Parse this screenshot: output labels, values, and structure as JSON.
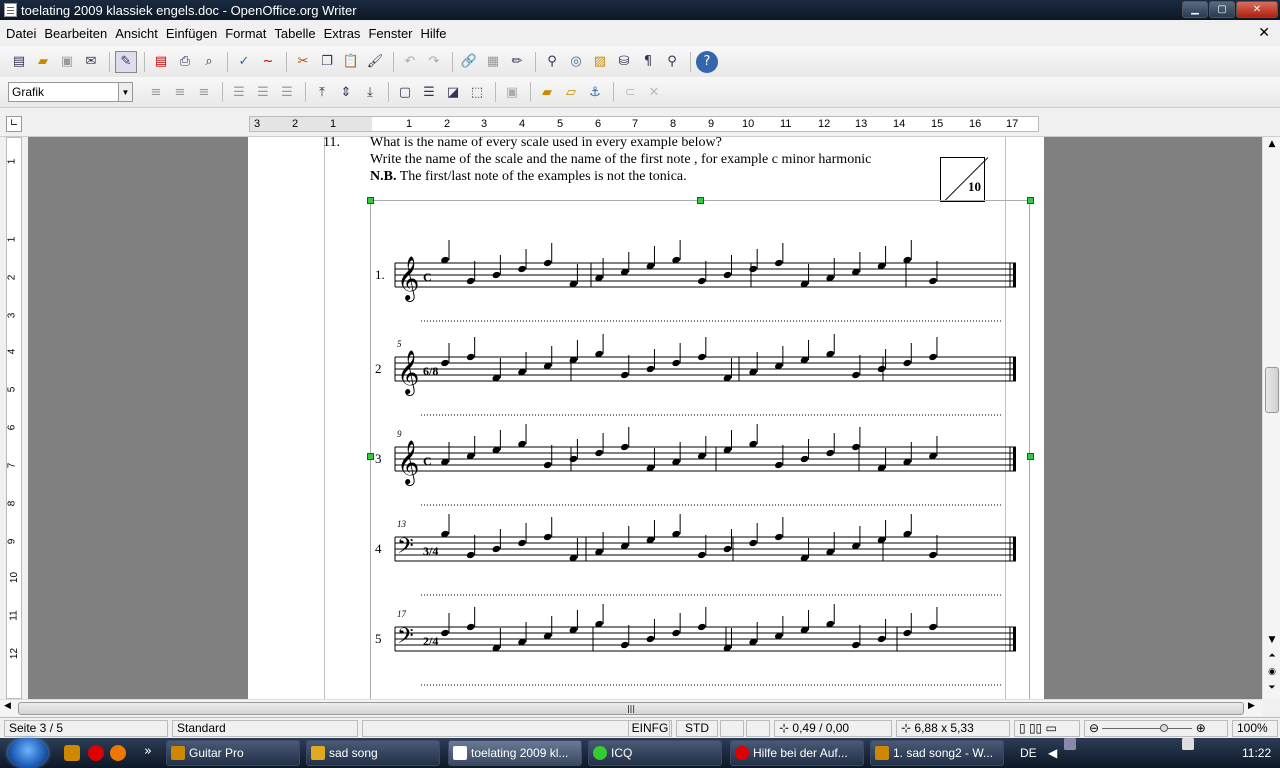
{
  "window": {
    "title": "toelating 2009 klassiek engels.doc - OpenOffice.org Writer",
    "min": "▁",
    "max": "▢",
    "close": "✕"
  },
  "menu": {
    "items": [
      "Datei",
      "Bearbeiten",
      "Ansicht",
      "Einfügen",
      "Format",
      "Tabelle",
      "Extras",
      "Fenster",
      "Hilfe"
    ],
    "close": "✕"
  },
  "toolbar2": {
    "style_value": "Grafik"
  },
  "ruler": {
    "h_neg": [
      "3",
      "2",
      "1"
    ],
    "h_pos": [
      "1",
      "2",
      "3",
      "4",
      "5",
      "6",
      "7",
      "8",
      "9",
      "10",
      "11",
      "12",
      "13",
      "14",
      "15",
      "16",
      "17"
    ],
    "v": [
      "1",
      "1",
      "2",
      "3",
      "4",
      "5",
      "6",
      "7",
      "8",
      "9",
      "10",
      "11",
      "12"
    ]
  },
  "document": {
    "question_number": "11.",
    "line1": "What is the name of every scale used in every example below?",
    "line2": "Write the name of the scale and the name of the first note ,  for example c minor harmonic",
    "line3_bold": "N.B.",
    "line3_rest": "  The first/last note of the examples is not the tonica.",
    "score_points": "10",
    "examples": [
      {
        "label": "1.",
        "measure": "",
        "clef": "𝄞",
        "time": "C"
      },
      {
        "label": "2",
        "measure": "5",
        "clef": "𝄞",
        "time": "6/8"
      },
      {
        "label": "3",
        "measure": "9",
        "clef": "𝄞",
        "time": "C"
      },
      {
        "label": "4",
        "measure": "13",
        "clef": "𝄢",
        "time": "3/4"
      },
      {
        "label": "5",
        "measure": "17",
        "clef": "𝄢",
        "time": "2/4"
      }
    ]
  },
  "statusbar": {
    "page": "Seite 3 / 5",
    "style": "Standard",
    "insert": "EINFG",
    "select": "STD",
    "position": "0,49 / 0,00",
    "size": "6,88 x 5,33",
    "zoom": "100%"
  },
  "taskbar": {
    "tasks": [
      "Guitar Pro",
      "sad song",
      "toelating 2009 kl...",
      "ICQ",
      "Hilfe bei der Auf...",
      "1. sad song2 - W..."
    ],
    "lang": "DE",
    "clock": "11:22",
    "more": "»"
  }
}
